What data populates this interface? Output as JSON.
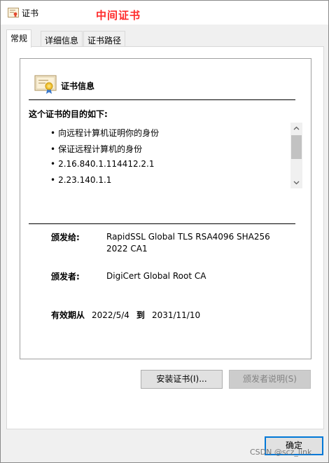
{
  "window": {
    "title": "证书",
    "annotation": "中间证书"
  },
  "tabs": [
    {
      "label": "常规",
      "active": true
    },
    {
      "label": "详细信息",
      "active": false
    },
    {
      "label": "证书路径",
      "active": false
    }
  ],
  "cert_info": {
    "heading": "证书信息",
    "purpose_heading": "这个证书的目的如下:",
    "purposes": [
      "向远程计算机证明你的身份",
      "保证远程计算机的身份",
      "2.16.840.1.114412.2.1",
      "2.23.140.1.1"
    ],
    "issued_to_label": "颁发给:",
    "issued_to_value": "RapidSSL Global TLS RSA4096 SHA256 2022 CA1",
    "issued_by_label": "颁发者:",
    "issued_by_value": "DigiCert Global Root CA",
    "valid_from_label": "有效期从",
    "valid_from": "2022/5/4",
    "valid_to_label": "到",
    "valid_to": "2031/11/10"
  },
  "buttons": {
    "install": "安装证书(I)...",
    "issuer_statement": "颁发者说明(S)",
    "ok": "确定"
  },
  "watermark": "CSDN @scz_link",
  "icons": {
    "window": "certificate-icon",
    "cert": "certificate-ribbon-icon",
    "scroll_up": "chevron-up-icon",
    "scroll_down": "chevron-down-icon"
  }
}
